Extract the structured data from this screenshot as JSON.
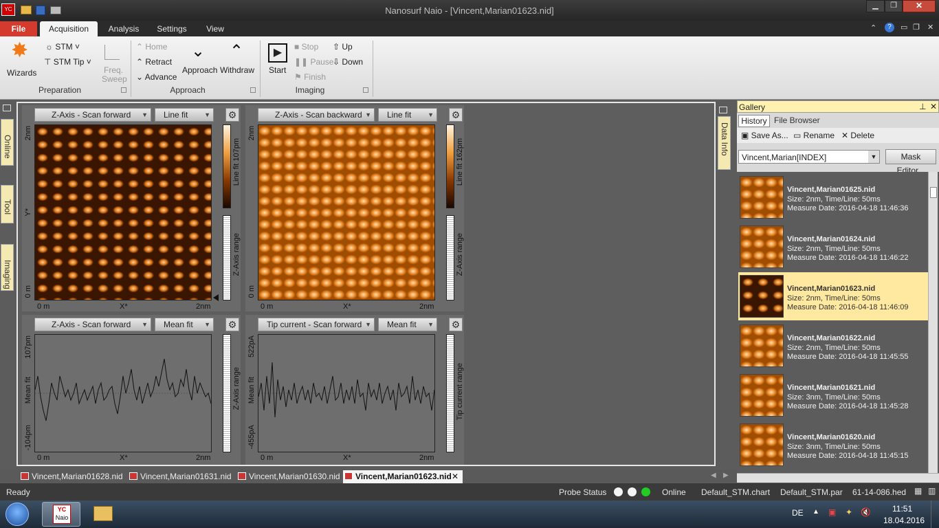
{
  "window": {
    "title": "Nanosurf Naio - [Vincent,Marian01623.nid]"
  },
  "ribbon_tabs": [
    "File",
    "Acquisition",
    "Analysis",
    "Settings",
    "View"
  ],
  "ribbon": {
    "wizards": "Wizards",
    "stm": "STM",
    "stm_tip": "STM Tip",
    "freq": "Freq.",
    "sweep": "Sweep",
    "home": "Home",
    "retract": "Retract",
    "advance": "Advance",
    "approach": "Approach",
    "withdraw": "Withdraw",
    "start": "Start",
    "stop": "Stop",
    "pause": "Pause",
    "finish": "Finish",
    "up": "Up",
    "down": "Down",
    "groups": {
      "preparation": "Preparation",
      "approach": "Approach",
      "imaging": "Imaging"
    }
  },
  "side_tabs": [
    "Online",
    "Tool",
    "Imaging"
  ],
  "data_info": "Data Info",
  "panels": [
    {
      "channel": "Z-Axis - Scan forward",
      "filter": "Line fit",
      "cbar": "Line fit 107pm",
      "range": "Z-Axis range",
      "y_top": "2nm",
      "y_mid": "Y*",
      "y_bot": "0 m",
      "x_left": "0 m",
      "x_mid": "X*",
      "x_right": "2nm"
    },
    {
      "channel": "Z-Axis - Scan backward",
      "filter": "Line fit",
      "cbar": "Line fit 162pm",
      "range": "Z-Axis range",
      "y_top": "2nm",
      "y_bot": "0 m",
      "x_left": "0 m",
      "x_mid": "X*",
      "x_right": "2nm"
    },
    {
      "channel": "Z-Axis - Scan forward",
      "filter": "Mean fit",
      "range": "Z-Axis range",
      "y_top": "107pm",
      "y_mid": "Mean fit",
      "y_bot": "-104pm",
      "x_left": "0 m",
      "x_mid": "X*",
      "x_right": "2nm"
    },
    {
      "channel": "Tip current - Scan forward",
      "filter": "Mean fit",
      "range": "Tip current range",
      "y_top": "522pA",
      "y_mid": "Mean fit",
      "y_bot": "-455pA",
      "x_left": "0 m",
      "x_mid": "X*",
      "x_right": "2nm"
    }
  ],
  "gallery": {
    "title": "Gallery",
    "tabs": [
      "History",
      "File Browser"
    ],
    "actions": [
      "Save As...",
      "Rename",
      "Delete"
    ],
    "filter_value": "Vincent,Marian[INDEX]",
    "mask_editor": "Mask Editor...",
    "items": [
      {
        "name": "Vincent,Marian01625.nid",
        "size": "Size: 2nm, Time/Line: 50ms",
        "date": "Measure Date: 2016-04-18 11:46:36"
      },
      {
        "name": "Vincent,Marian01624.nid",
        "size": "Size: 2nm, Time/Line: 50ms",
        "date": "Measure Date: 2016-04-18 11:46:22"
      },
      {
        "name": "Vincent,Marian01623.nid",
        "size": "Size: 2nm, Time/Line: 50ms",
        "date": "Measure Date: 2016-04-18 11:46:09"
      },
      {
        "name": "Vincent,Marian01622.nid",
        "size": "Size: 2nm, Time/Line: 50ms",
        "date": "Measure Date: 2016-04-18 11:45:55"
      },
      {
        "name": "Vincent,Marian01621.nid",
        "size": "Size: 3nm, Time/Line: 50ms",
        "date": "Measure Date: 2016-04-18 11:45:28"
      },
      {
        "name": "Vincent,Marian01620.nid",
        "size": "Size: 3nm, Time/Line: 50ms",
        "date": "Measure Date: 2016-04-18 11:45:15"
      }
    ]
  },
  "doc_tabs": [
    "Vincent,Marian01628.nid",
    "Vincent,Marian01631.nid",
    "Vincent,Marian01630.nid",
    "Vincent,Marian01623.nid"
  ],
  "status": {
    "ready": "Ready",
    "probe": "Probe Status",
    "online": "Online",
    "chart": "Default_STM.chart",
    "par": "Default_STM.par",
    "hed": "61-14-086.hed"
  },
  "taskbar": {
    "app": "Naio",
    "lang": "DE",
    "time": "11:51",
    "date": "18.04.2016"
  }
}
